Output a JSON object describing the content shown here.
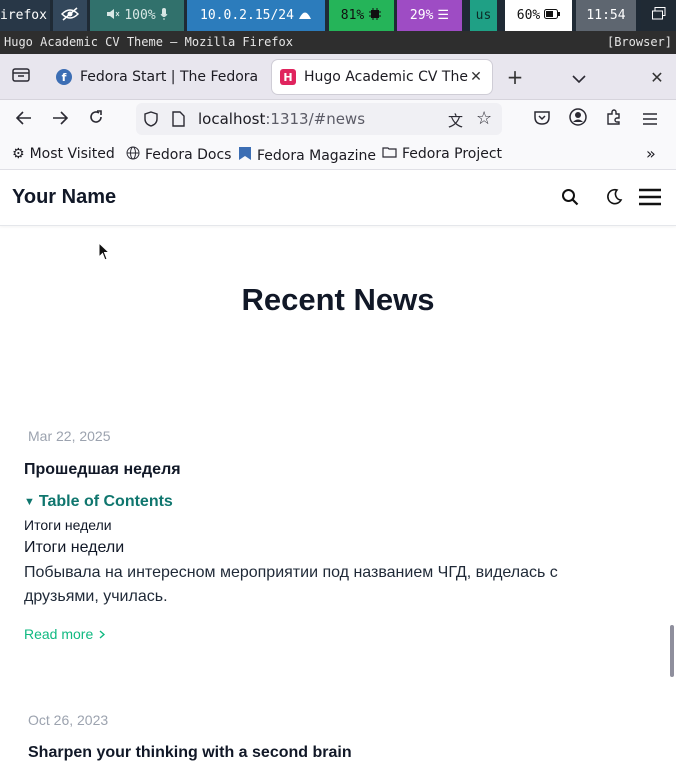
{
  "system_bar": {
    "app": "irefox",
    "volume": "100%",
    "ip": "10.0.2.15/24",
    "cpu": "81%",
    "memory": "29%",
    "keyboard": "us",
    "battery": "60%",
    "clock": "11:54"
  },
  "window": {
    "title": "Hugo Academic CV Theme — Mozilla Firefox",
    "tag": "[Browser]"
  },
  "tabs": [
    {
      "label": "Fedora Start | The Fedora",
      "favicon": "F"
    },
    {
      "label": "Hugo Academic CV Theme",
      "favicon": "H"
    }
  ],
  "address_bar": {
    "host": "localhost",
    "path": ":1313/#news"
  },
  "bookmarks": [
    "Most Visited",
    "Fedora Docs",
    "Fedora Magazine",
    "Fedora Project"
  ],
  "site": {
    "brand": "Your Name",
    "section_title": "Recent News"
  },
  "news": [
    {
      "date": "Mar 22, 2025",
      "title": "Прошедшая неделя",
      "toc_label": "Table of Contents",
      "toc_item": "Итоги недели",
      "heading": "Итоги недели",
      "body": "Побывала на интересном мероприятии под названием ЧГД, виделась с друзьями, училась.",
      "read_more": "Read more"
    },
    {
      "date": "Oct 26, 2023",
      "title": "Sharpen your thinking with a second brain"
    }
  ],
  "colors": {
    "accent_green": "#10b981",
    "toc_teal": "#0f766e",
    "heading": "#111827"
  }
}
